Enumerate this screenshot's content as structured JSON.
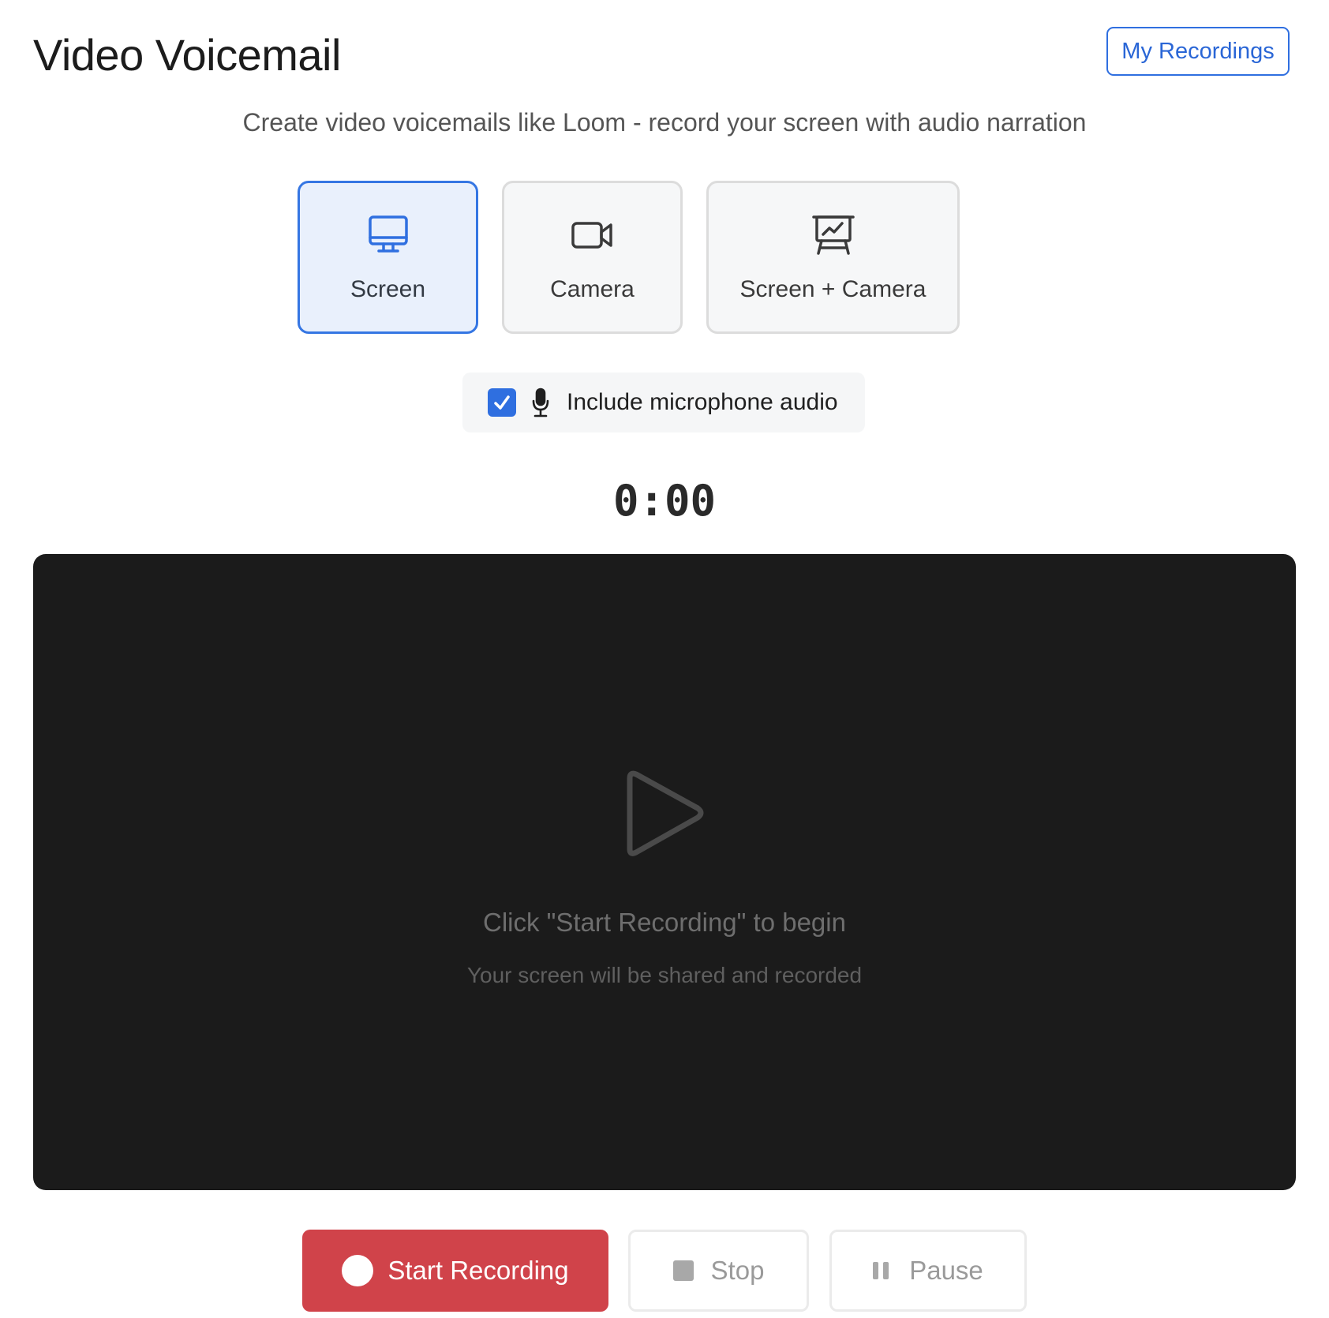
{
  "header": {
    "title": "Video Voicemail",
    "my_recordings_label": "My Recordings"
  },
  "subtitle": "Create video voicemails like Loom - record your screen with audio narration",
  "modes": [
    {
      "label": "Screen",
      "icon": "monitor-icon",
      "selected": true
    },
    {
      "label": "Camera",
      "icon": "video-camera-icon",
      "selected": false
    },
    {
      "label": "Screen + Camera",
      "icon": "presentation-icon",
      "selected": false
    }
  ],
  "microphone": {
    "checked": true,
    "label": "Include microphone audio",
    "icon": "microphone-icon"
  },
  "timer": "0:00",
  "preview": {
    "icon": "play-icon",
    "title": "Click \"Start Recording\" to begin",
    "subtitle": "Your screen will be shared and recorded"
  },
  "controls": {
    "start_label": "Start Recording",
    "stop_label": "Stop",
    "pause_label": "Pause"
  },
  "colors": {
    "accent": "#2f6fe0",
    "record": "#d0434a",
    "preview_bg": "#1b1b1b"
  }
}
